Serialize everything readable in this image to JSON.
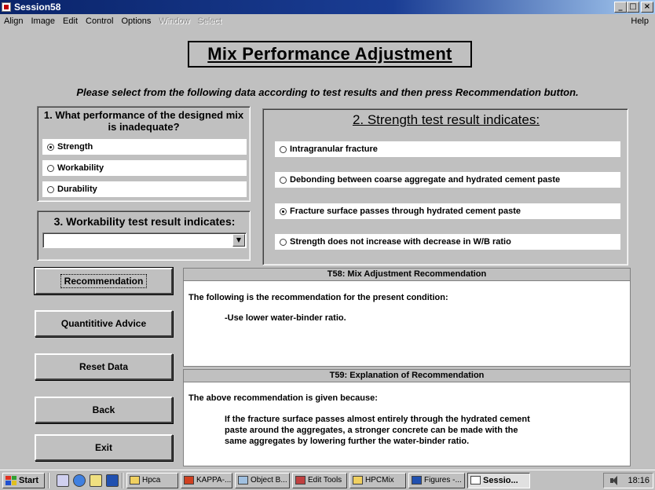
{
  "window": {
    "title": "Session58",
    "buttons": {
      "minimize": "_",
      "maximize": "□",
      "close": "×"
    }
  },
  "menu": {
    "items": [
      "Align",
      "Image",
      "Edit",
      "Control",
      "Options",
      "Window",
      "Select"
    ],
    "disabled": [
      "Window",
      "Select"
    ],
    "help": "Help"
  },
  "heading": "Mix Performance Adjustment",
  "instructions": "Please select from the following data according to test results and then press Recommendation button.",
  "panel1": {
    "title": "1. What performance of the designed mix is inadequate?",
    "options": [
      {
        "label": "Strength",
        "checked": true
      },
      {
        "label": "Workability",
        "checked": false
      },
      {
        "label": "Durability",
        "checked": false
      }
    ]
  },
  "panel2": {
    "title": "2. Strength test result indicates:",
    "options": [
      {
        "label": "Intragranular fracture",
        "checked": false
      },
      {
        "label": "Debonding between coarse aggregate and hydrated cement paste",
        "checked": false
      },
      {
        "label": "Fracture surface passes through hydrated cement paste",
        "checked": true
      },
      {
        "label": "Strength does not increase with decrease in W/B ratio",
        "checked": false
      }
    ]
  },
  "panel3": {
    "title": "3. Workability test result indicates:",
    "value": ""
  },
  "buttons": {
    "recommendation": "Recommendation",
    "quantitative": "Quantititive Advice",
    "reset": "Reset Data",
    "back": "Back",
    "exit": "Exit"
  },
  "box58": {
    "title": "T58: Mix Adjustment Recommendation",
    "intro": "The following is the recommendation for the present condition:",
    "item": "-Use lower water-binder ratio."
  },
  "box59": {
    "title": "T59: Explanation of Recommendation",
    "intro": "The above recommendation is given because:",
    "lines": [
      "If the fracture surface passes almost entirely through the hydrated cement",
      "paste around the aggregates, a stronger concrete can be made with the",
      "same aggregates by lowering further the water-binder ratio."
    ]
  },
  "taskbar": {
    "start": "Start",
    "tasks": [
      "Hpca",
      "KAPPA-...",
      "Object B...",
      "Edit Tools",
      "HPCMix",
      "Figures -...",
      "Sessio..."
    ],
    "active_task": "Sessio...",
    "clock": "18:16"
  },
  "colors": {
    "titlebar": "#0a246a",
    "face": "#c0c0c0",
    "panel_bg": "#ffffff"
  }
}
